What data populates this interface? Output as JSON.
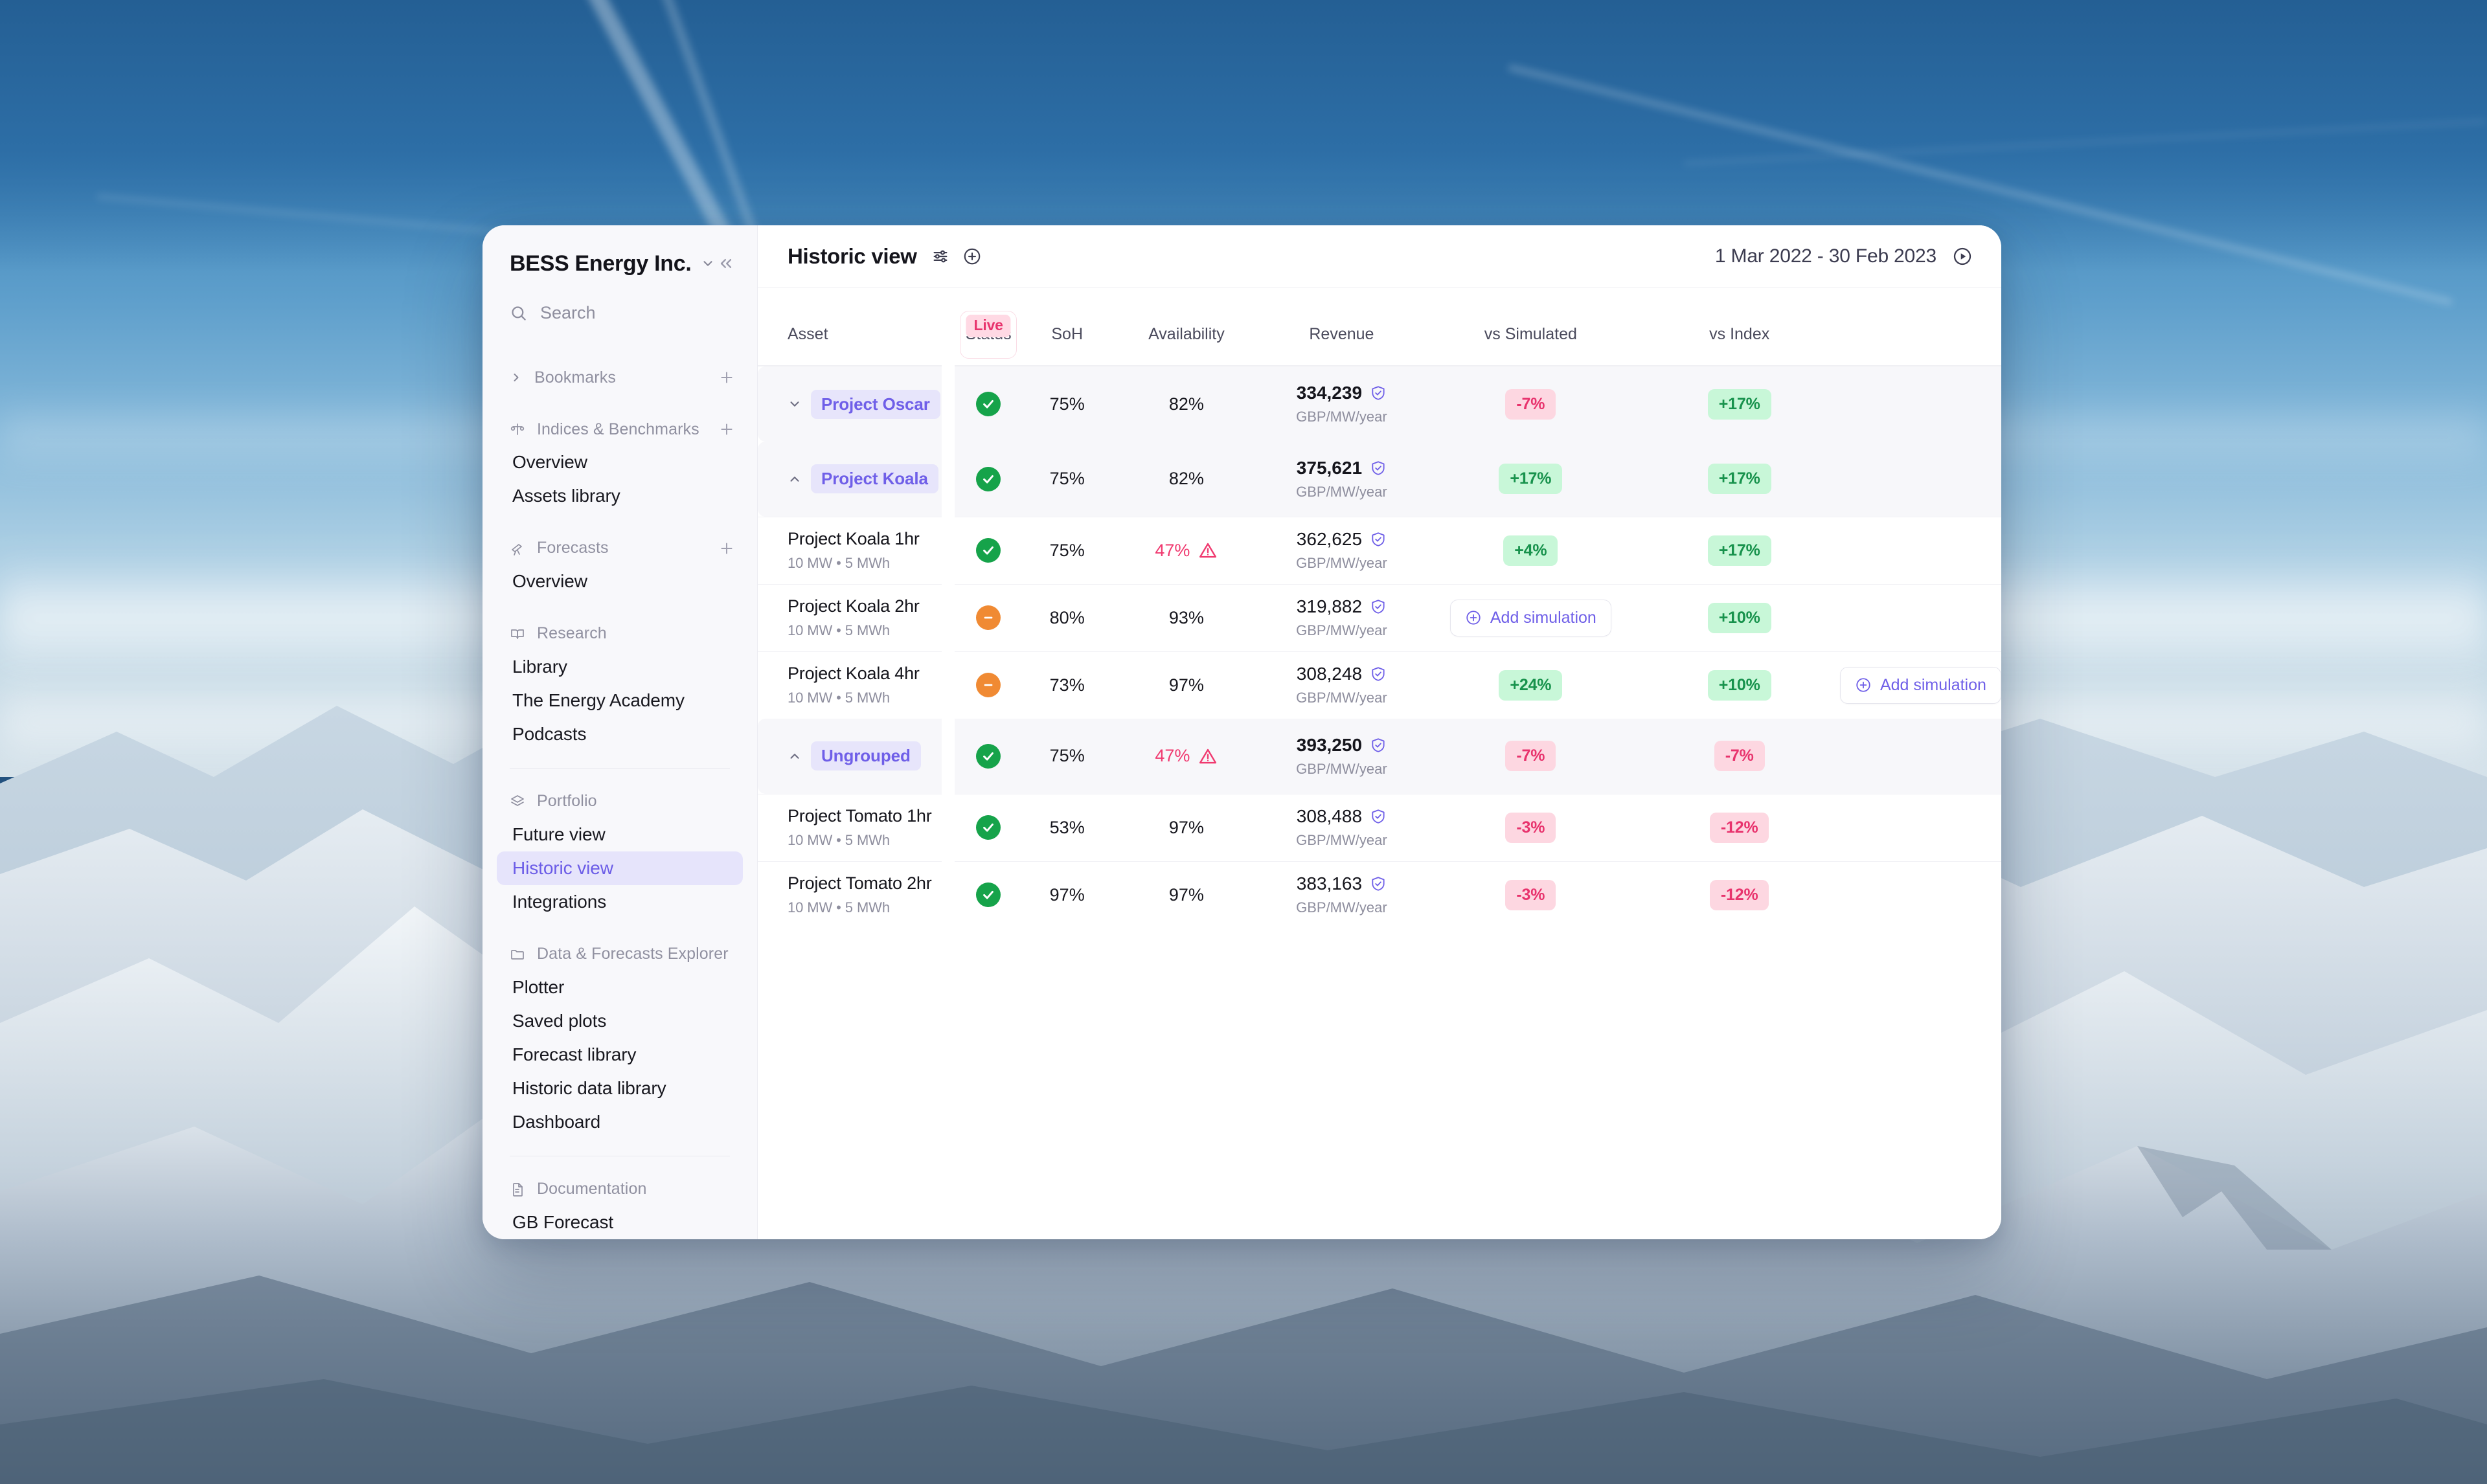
{
  "sidebar": {
    "org": {
      "name": "BESS Energy Inc.",
      "caret_icon": "chevron-down-icon",
      "collapse_icon": "chevrons-left-icon"
    },
    "search": {
      "placeholder": "Search",
      "icon": "search-icon"
    },
    "sections": [
      {
        "key": "bookmarks",
        "label": "Bookmarks",
        "icon": "chevron-right-icon",
        "action": "+",
        "items": []
      },
      {
        "key": "indices",
        "label": "Indices & Benchmarks",
        "icon": "scales-icon",
        "action": "+",
        "items": [
          "Overview",
          "Assets library"
        ]
      },
      {
        "key": "forecasts",
        "label": "Forecasts",
        "icon": "telescope-icon",
        "action": "+",
        "items": [
          "Overview"
        ]
      },
      {
        "key": "research",
        "label": "Research",
        "icon": "book-icon",
        "action": "",
        "items": [
          "Library",
          "The Energy Academy",
          "Podcasts"
        ]
      },
      {
        "key": "portfolio",
        "label": "Portfolio",
        "icon": "layers-icon",
        "action": "",
        "items": [
          "Future view",
          "Historic view",
          "Integrations"
        ]
      },
      {
        "key": "explorer",
        "label": "Data & Forecasts Explorer",
        "icon": "folder-icon",
        "action": "",
        "items": [
          "Plotter",
          "Saved plots",
          "Forecast library",
          "Historic data library",
          "Dashboard"
        ]
      },
      {
        "key": "documentation",
        "label": "Documentation",
        "icon": "document-icon",
        "action": "",
        "items": [
          "GB Forecast"
        ]
      }
    ],
    "active_item": "Historic view"
  },
  "topbar": {
    "title": "Historic view",
    "settings_icon": "sliders-icon",
    "add_icon": "plus-circle-icon",
    "date_range": "1 Mar 2022 - 30 Feb 2023",
    "play_icon": "play-circle-icon"
  },
  "table": {
    "headers": {
      "asset": "Asset",
      "status": "Status",
      "soh": "SoH",
      "live_badge": "Live",
      "availability": "Availability",
      "revenue": "Revenue",
      "vs_simulated": "vs Simulated",
      "vs_index": "vs Index"
    },
    "revenue_unit": "GBP/MW/year",
    "add_simulation_label": "Add simulation",
    "rows": [
      {
        "type": "group",
        "name": "Project Oscar",
        "caret": "chevron-down-icon",
        "status": "ok",
        "soh": "75%",
        "availability": "82%",
        "availability_warn": false,
        "revenue": "334,239",
        "revenue_unit": "GBP/MW/year",
        "revenue_verified": true,
        "vs_simulated": {
          "kind": "badge",
          "value": "-7%",
          "tone": "neg"
        },
        "vs_index": {
          "kind": "badge",
          "value": "+17%",
          "tone": "pos"
        },
        "tail": null
      },
      {
        "type": "group",
        "name": "Project Koala",
        "caret": "chevron-up-icon",
        "status": "ok",
        "soh": "75%",
        "availability": "82%",
        "availability_warn": false,
        "revenue": "375,621",
        "revenue_unit": "GBP/MW/year",
        "revenue_verified": true,
        "vs_simulated": {
          "kind": "badge",
          "value": "+17%",
          "tone": "pos"
        },
        "vs_index": {
          "kind": "badge",
          "value": "+17%",
          "tone": "pos"
        },
        "tail": null
      },
      {
        "type": "child",
        "name": "Project Koala 1hr",
        "sub": "10 MW • 5 MWh",
        "status": "ok",
        "soh": "75%",
        "availability": "47%",
        "availability_warn": true,
        "revenue": "362,625",
        "revenue_unit": "GBP/MW/year",
        "revenue_verified": true,
        "vs_simulated": {
          "kind": "badge",
          "value": "+4%",
          "tone": "pos"
        },
        "vs_index": {
          "kind": "badge",
          "value": "+17%",
          "tone": "pos"
        },
        "tail": null
      },
      {
        "type": "child",
        "name": "Project Koala 2hr",
        "sub": "10 MW • 5 MWh",
        "status": "warn",
        "soh": "80%",
        "availability": "93%",
        "availability_warn": false,
        "revenue": "319,882",
        "revenue_unit": "GBP/MW/year",
        "revenue_verified": true,
        "vs_simulated": {
          "kind": "button",
          "value": "Add simulation"
        },
        "vs_index": {
          "kind": "badge",
          "value": "+10%",
          "tone": "pos"
        },
        "tail": null
      },
      {
        "type": "child",
        "name": "Project Koala 4hr",
        "sub": "10 MW • 5 MWh",
        "status": "warn",
        "soh": "73%",
        "availability": "97%",
        "availability_warn": false,
        "revenue": "308,248",
        "revenue_unit": "GBP/MW/year",
        "revenue_verified": true,
        "vs_simulated": {
          "kind": "badge",
          "value": "+24%",
          "tone": "pos"
        },
        "vs_index": {
          "kind": "badge",
          "value": "+10%",
          "tone": "pos"
        },
        "tail": {
          "kind": "button",
          "value": "Add simulation"
        }
      },
      {
        "type": "group",
        "name": "Ungrouped",
        "caret": "chevron-up-icon",
        "status": "ok",
        "soh": "75%",
        "availability": "47%",
        "availability_warn": true,
        "revenue": "393,250",
        "revenue_unit": "GBP/MW/year",
        "revenue_verified": true,
        "vs_simulated": {
          "kind": "badge",
          "value": "-7%",
          "tone": "neg"
        },
        "vs_index": {
          "kind": "badge",
          "value": "-7%",
          "tone": "neg"
        },
        "tail": null
      },
      {
        "type": "child",
        "name": "Project Tomato 1hr",
        "sub": "10 MW • 5 MWh",
        "status": "ok",
        "soh": "53%",
        "availability": "97%",
        "availability_warn": false,
        "revenue": "308,488",
        "revenue_unit": "GBP/MW/year",
        "revenue_verified": true,
        "vs_simulated": {
          "kind": "badge",
          "value": "-3%",
          "tone": "neg"
        },
        "vs_index": {
          "kind": "badge",
          "value": "-12%",
          "tone": "neg"
        },
        "tail": null
      },
      {
        "type": "child",
        "name": "Project Tomato 2hr",
        "sub": "10 MW • 5 MWh",
        "status": "ok",
        "soh": "97%",
        "availability": "97%",
        "availability_warn": false,
        "revenue": "383,163",
        "revenue_unit": "GBP/MW/year",
        "revenue_verified": true,
        "vs_simulated": {
          "kind": "badge",
          "value": "-3%",
          "tone": "neg"
        },
        "vs_index": {
          "kind": "badge",
          "value": "-12%",
          "tone": "neg"
        },
        "tail": null
      }
    ]
  },
  "colors": {
    "accent": "#6f5fe8",
    "status_ok": "#16a34a",
    "status_warn": "#f08a33",
    "positive_bg": "#c8f7d8",
    "positive_fg": "#17924c",
    "negative_bg": "#fdd7e1",
    "negative_fg": "#e8336d",
    "live_bg": "#ffd9e4",
    "live_fg": "#e8336d"
  }
}
